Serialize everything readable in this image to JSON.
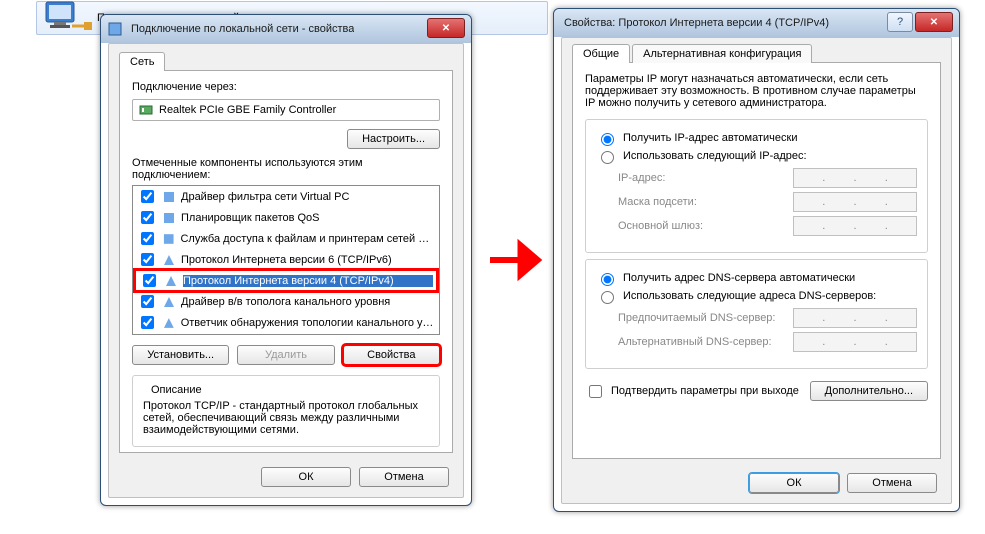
{
  "header_item_label": "Подключение по локальной сети",
  "win1": {
    "title": "Подключение по локальной сети - свойства",
    "tab_label": "Сеть",
    "connect_via_label": "Подключение через:",
    "adapter_name": "Realtek PCIe GBE Family Controller",
    "configure_btn": "Настроить...",
    "components_label": "Отмеченные компоненты используются этим подключением:",
    "items": [
      "Драйвер фильтра сети Virtual PC",
      "Планировщик пакетов QoS",
      "Служба доступа к файлам и принтерам сетей Micro",
      "Протокол Интернета версии 6 (TCP/IPv6)",
      "Протокол Интернета версии 4 (TCP/IPv4)",
      "Драйвер в/в тополога канального уровня",
      "Ответчик обнаружения топологии канального уров"
    ],
    "install_btn": "Установить...",
    "remove_btn": "Удалить",
    "properties_btn": "Свойства",
    "description_label": "Описание",
    "description_text": "Протокол TCP/IP - стандартный протокол глобальных сетей, обеспечивающий связь между различными взаимодействующими сетями.",
    "ok": "ОК",
    "cancel": "Отмена"
  },
  "win2": {
    "title": "Свойства: Протокол Интернета версии 4 (TCP/IPv4)",
    "tab_general": "Общие",
    "tab_alt": "Альтернативная конфигурация",
    "help_text": "Параметры IP могут назначаться автоматически, если сеть поддерживает эту возможность. В противном случае параметры IP можно получить у сетевого администратора.",
    "ip_auto": "Получить IP-адрес автоматически",
    "ip_manual": "Использовать следующий IP-адрес:",
    "ip_addr_lbl": "IP-адрес:",
    "mask_lbl": "Маска подсети:",
    "gateway_lbl": "Основной шлюз:",
    "dns_auto": "Получить адрес DNS-сервера автоматически",
    "dns_manual": "Использовать следующие адреса DNS-серверов:",
    "dns_pref_lbl": "Предпочитаемый DNS-сервер:",
    "dns_alt_lbl": "Альтернативный DNS-сервер:",
    "confirm_on_exit": "Подтвердить параметры при выходе",
    "advanced_btn": "Дополнительно...",
    "ok": "ОК",
    "cancel": "Отмена"
  }
}
